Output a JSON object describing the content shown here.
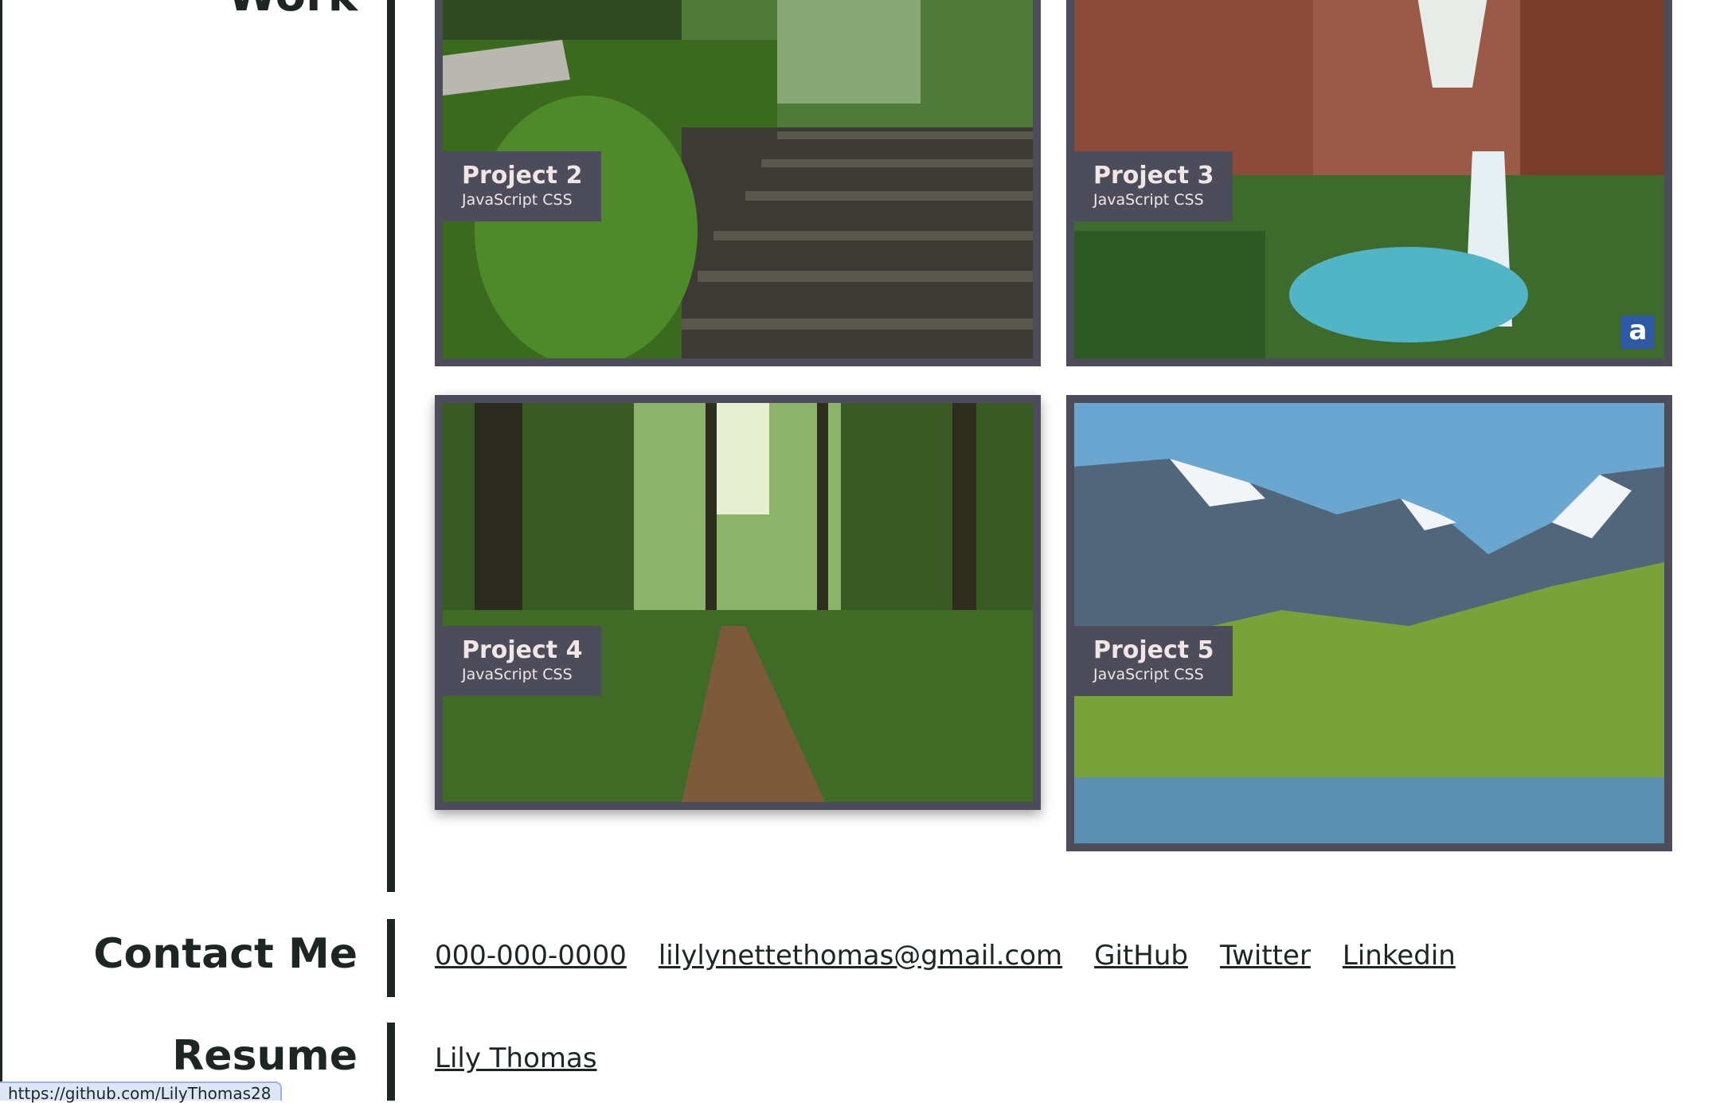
{
  "sections": {
    "work": {
      "heading": "Work"
    },
    "contact": {
      "heading": "Contact Me"
    },
    "resume": {
      "heading": "Resume"
    }
  },
  "projects": [
    {
      "title": "Project 2",
      "tags": "JavaScript CSS"
    },
    {
      "title": "Project 3",
      "tags": "JavaScript CSS"
    },
    {
      "title": "Project 4",
      "tags": "JavaScript CSS"
    },
    {
      "title": "Project 5",
      "tags": "JavaScript CSS"
    }
  ],
  "watermark_badge": "a",
  "contact_links": {
    "phone": "000-000-0000",
    "email": "lilylynettethomas@gmail.com",
    "github": "GitHub",
    "twitter": "Twitter",
    "linkedin": "Linkedin"
  },
  "resume": {
    "link_text": "Lily Thomas"
  },
  "status_bar": {
    "url": "https://github.com/LilyThomas28"
  },
  "colors": {
    "frame": "#4d4c5b",
    "text": "#1e2624",
    "label_text": "#f0e6e6"
  }
}
